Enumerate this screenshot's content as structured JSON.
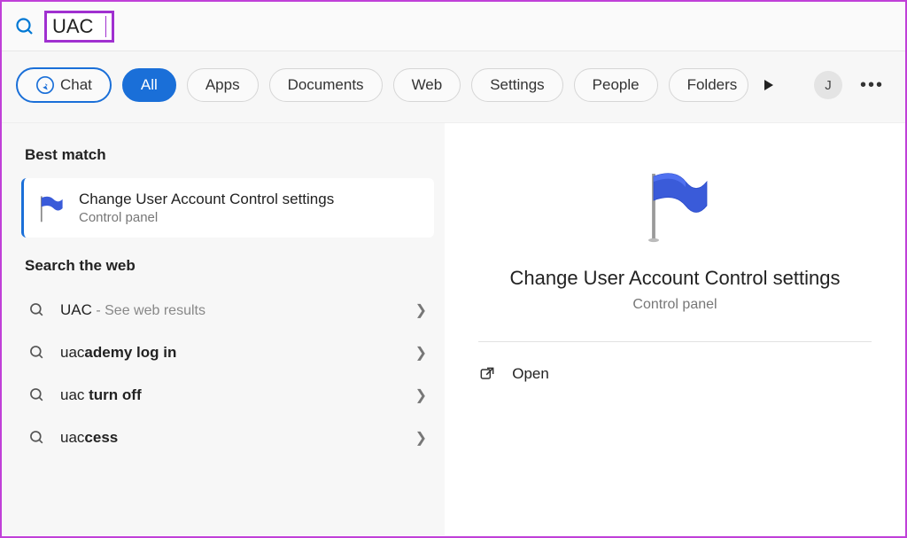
{
  "search": {
    "value": "UAC"
  },
  "filters": {
    "chat": "Chat",
    "items": [
      "All",
      "Apps",
      "Documents",
      "Web",
      "Settings",
      "People",
      "Folders"
    ],
    "active_index": 0,
    "avatar_initial": "J"
  },
  "best_match": {
    "heading": "Best match",
    "title": "Change User Account Control settings",
    "subtitle": "Control panel"
  },
  "web": {
    "heading": "Search the web",
    "items": [
      {
        "prefix": "UAC",
        "bold": "",
        "suffix": " - See web results",
        "suffix_muted": true
      },
      {
        "prefix": "uac",
        "bold": "ademy log in",
        "suffix": ""
      },
      {
        "prefix": "uac ",
        "bold": "turn off",
        "suffix": ""
      },
      {
        "prefix": "uac",
        "bold": "cess",
        "suffix": ""
      }
    ]
  },
  "detail": {
    "title": "Change User Account Control settings",
    "subtitle": "Control panel",
    "open_label": "Open"
  }
}
